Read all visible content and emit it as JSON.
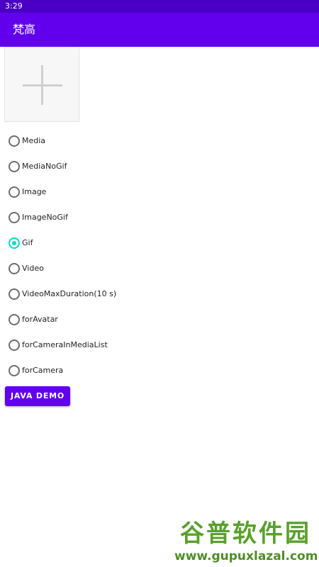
{
  "status_bar": {
    "time": "3:29"
  },
  "app_bar": {
    "title": "梵高"
  },
  "picker": {
    "add_icon": "plus-icon"
  },
  "radio_options": [
    {
      "label": "Media",
      "checked": false
    },
    {
      "label": "MediaNoGif",
      "checked": false
    },
    {
      "label": "Image",
      "checked": false
    },
    {
      "label": "ImageNoGif",
      "checked": false
    },
    {
      "label": "Gif",
      "checked": true
    },
    {
      "label": "Video",
      "checked": false
    },
    {
      "label": "VideoMaxDuration(10 s)",
      "checked": false
    },
    {
      "label": "forAvatar",
      "checked": false
    },
    {
      "label": "forCameraInMediaList",
      "checked": false
    },
    {
      "label": "forCamera",
      "checked": false
    }
  ],
  "java_demo_button": {
    "label": "JAVA DEMO"
  },
  "watermark": {
    "name": "谷普软件园",
    "url": "www.gupuxlazal.com"
  },
  "colors": {
    "status_bar": "#4a00c4",
    "app_bar": "#6200ee",
    "accent": "#03dac5",
    "button": "#6200ee"
  }
}
